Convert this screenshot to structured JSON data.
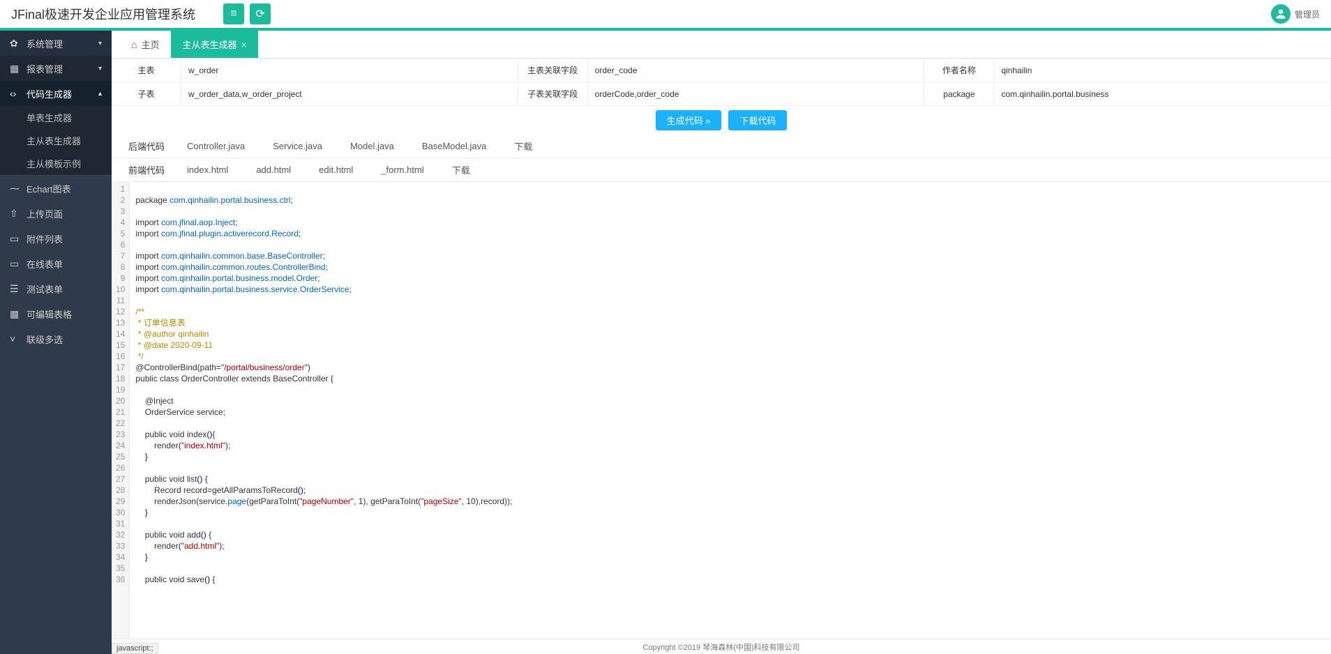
{
  "header": {
    "title": "JFinal极速开发企业应用管理系统",
    "user": "管理员"
  },
  "sidebar": {
    "items": [
      {
        "label": "系统管理",
        "icon": "gear"
      },
      {
        "label": "报表管理",
        "icon": "grid"
      },
      {
        "label": "代码生成器",
        "icon": "code",
        "expanded": true
      },
      {
        "label": "Echart图表",
        "icon": "pulse"
      },
      {
        "label": "上传页面",
        "icon": "upload"
      },
      {
        "label": "附件列表",
        "icon": "book"
      },
      {
        "label": "在线表单",
        "icon": "form"
      },
      {
        "label": "测试表单",
        "icon": "list"
      },
      {
        "label": "可编辑表格",
        "icon": "table"
      },
      {
        "label": "联级多选",
        "icon": "chevron"
      }
    ],
    "subs": [
      {
        "label": "单表生成器"
      },
      {
        "label": "主从表生成器"
      },
      {
        "label": "主从模板示例"
      }
    ]
  },
  "tabs": {
    "home": "主页",
    "active": "主从表生成器"
  },
  "form": {
    "r1": {
      "l1": "主表",
      "v1": "w_order",
      "l2": "主表关联字段",
      "v2": "order_code",
      "l3": "作者名称",
      "v3": "qinhailin"
    },
    "r2": {
      "l1": "子表",
      "v1": "w_order_data,w_order_project",
      "l2": "子表关联字段",
      "v2": "orderCode,order_code",
      "l3": "package",
      "v3": "com.qinhailin.portal.business"
    }
  },
  "buttons": {
    "gen": "生成代码 »",
    "dl": "下载代码"
  },
  "codetabs": {
    "back_head": "后端代码",
    "back": [
      "Controller.java",
      "Service.java",
      "Model.java",
      "BaseModel.java",
      "下载"
    ],
    "front_head": "前端代码",
    "front": [
      "index.html",
      "add.html",
      "edit.html",
      "_form.html",
      "下载"
    ]
  },
  "code": {
    "lines": 36,
    "pkg_line": "com.qinhailin.portal.business.ctrl",
    "imports": [
      "com.jfinal.aop.Inject",
      "com.jfinal.plugin.activerecord.Record",
      "",
      "com.qinhailin.common.base.BaseController",
      "com.qinhailin.common.routes.ControllerBind",
      "com.qinhailin.portal.business.model.Order",
      "com.qinhailin.portal.business.service.OrderService"
    ],
    "doc_title": " * 订单信息表",
    "doc_author": " * @author qinhailin",
    "doc_date": " * @date 2020-09-11",
    "ctrl_path": "/portal/business/order",
    "class_line": "public class OrderController extends BaseController {",
    "svc_line": "    OrderService service;",
    "idx_render": "index.html",
    "page_num": "pageNumber",
    "page_size": "pageSize",
    "add_render": "add.html"
  },
  "footer": {
    "copyright": "Copyright ©2019 琴海森林(中国)科技有限公司",
    "status": "javascript:;"
  }
}
